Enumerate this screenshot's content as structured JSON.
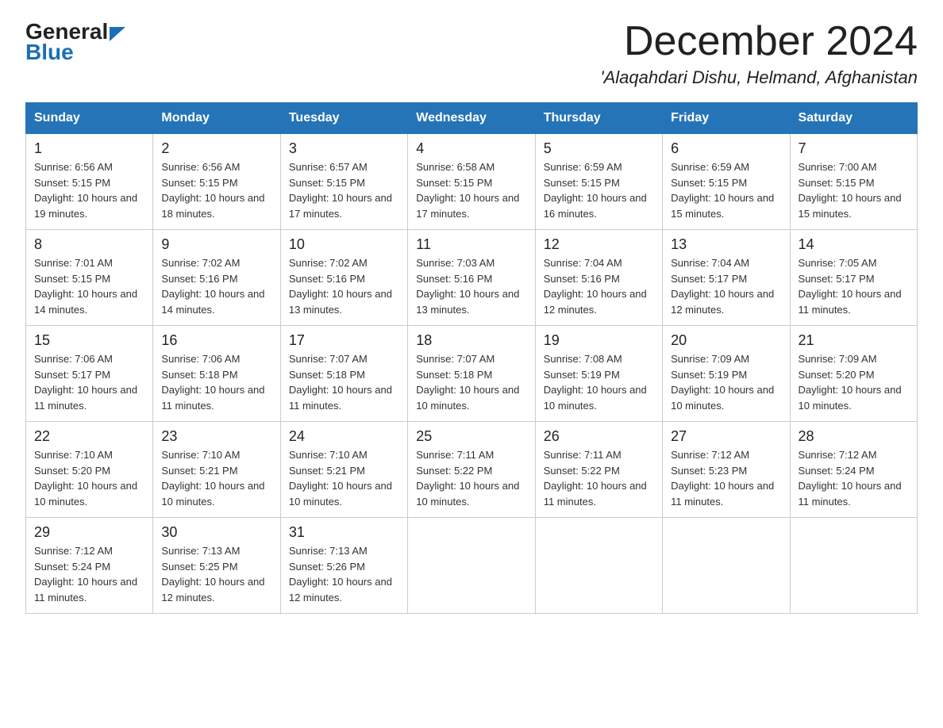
{
  "header": {
    "title": "December 2024",
    "subtitle": "'Alaqahdari Dishu, Helmand, Afghanistan",
    "logo_general": "General",
    "logo_blue": "Blue"
  },
  "days_of_week": [
    "Sunday",
    "Monday",
    "Tuesday",
    "Wednesday",
    "Thursday",
    "Friday",
    "Saturday"
  ],
  "weeks": [
    [
      {
        "date": "1",
        "sunrise": "6:56 AM",
        "sunset": "5:15 PM",
        "daylight": "10 hours and 19 minutes."
      },
      {
        "date": "2",
        "sunrise": "6:56 AM",
        "sunset": "5:15 PM",
        "daylight": "10 hours and 18 minutes."
      },
      {
        "date": "3",
        "sunrise": "6:57 AM",
        "sunset": "5:15 PM",
        "daylight": "10 hours and 17 minutes."
      },
      {
        "date": "4",
        "sunrise": "6:58 AM",
        "sunset": "5:15 PM",
        "daylight": "10 hours and 17 minutes."
      },
      {
        "date": "5",
        "sunrise": "6:59 AM",
        "sunset": "5:15 PM",
        "daylight": "10 hours and 16 minutes."
      },
      {
        "date": "6",
        "sunrise": "6:59 AM",
        "sunset": "5:15 PM",
        "daylight": "10 hours and 15 minutes."
      },
      {
        "date": "7",
        "sunrise": "7:00 AM",
        "sunset": "5:15 PM",
        "daylight": "10 hours and 15 minutes."
      }
    ],
    [
      {
        "date": "8",
        "sunrise": "7:01 AM",
        "sunset": "5:15 PM",
        "daylight": "10 hours and 14 minutes."
      },
      {
        "date": "9",
        "sunrise": "7:02 AM",
        "sunset": "5:16 PM",
        "daylight": "10 hours and 14 minutes."
      },
      {
        "date": "10",
        "sunrise": "7:02 AM",
        "sunset": "5:16 PM",
        "daylight": "10 hours and 13 minutes."
      },
      {
        "date": "11",
        "sunrise": "7:03 AM",
        "sunset": "5:16 PM",
        "daylight": "10 hours and 13 minutes."
      },
      {
        "date": "12",
        "sunrise": "7:04 AM",
        "sunset": "5:16 PM",
        "daylight": "10 hours and 12 minutes."
      },
      {
        "date": "13",
        "sunrise": "7:04 AM",
        "sunset": "5:17 PM",
        "daylight": "10 hours and 12 minutes."
      },
      {
        "date": "14",
        "sunrise": "7:05 AM",
        "sunset": "5:17 PM",
        "daylight": "10 hours and 11 minutes."
      }
    ],
    [
      {
        "date": "15",
        "sunrise": "7:06 AM",
        "sunset": "5:17 PM",
        "daylight": "10 hours and 11 minutes."
      },
      {
        "date": "16",
        "sunrise": "7:06 AM",
        "sunset": "5:18 PM",
        "daylight": "10 hours and 11 minutes."
      },
      {
        "date": "17",
        "sunrise": "7:07 AM",
        "sunset": "5:18 PM",
        "daylight": "10 hours and 11 minutes."
      },
      {
        "date": "18",
        "sunrise": "7:07 AM",
        "sunset": "5:18 PM",
        "daylight": "10 hours and 10 minutes."
      },
      {
        "date": "19",
        "sunrise": "7:08 AM",
        "sunset": "5:19 PM",
        "daylight": "10 hours and 10 minutes."
      },
      {
        "date": "20",
        "sunrise": "7:09 AM",
        "sunset": "5:19 PM",
        "daylight": "10 hours and 10 minutes."
      },
      {
        "date": "21",
        "sunrise": "7:09 AM",
        "sunset": "5:20 PM",
        "daylight": "10 hours and 10 minutes."
      }
    ],
    [
      {
        "date": "22",
        "sunrise": "7:10 AM",
        "sunset": "5:20 PM",
        "daylight": "10 hours and 10 minutes."
      },
      {
        "date": "23",
        "sunrise": "7:10 AM",
        "sunset": "5:21 PM",
        "daylight": "10 hours and 10 minutes."
      },
      {
        "date": "24",
        "sunrise": "7:10 AM",
        "sunset": "5:21 PM",
        "daylight": "10 hours and 10 minutes."
      },
      {
        "date": "25",
        "sunrise": "7:11 AM",
        "sunset": "5:22 PM",
        "daylight": "10 hours and 10 minutes."
      },
      {
        "date": "26",
        "sunrise": "7:11 AM",
        "sunset": "5:22 PM",
        "daylight": "10 hours and 11 minutes."
      },
      {
        "date": "27",
        "sunrise": "7:12 AM",
        "sunset": "5:23 PM",
        "daylight": "10 hours and 11 minutes."
      },
      {
        "date": "28",
        "sunrise": "7:12 AM",
        "sunset": "5:24 PM",
        "daylight": "10 hours and 11 minutes."
      }
    ],
    [
      {
        "date": "29",
        "sunrise": "7:12 AM",
        "sunset": "5:24 PM",
        "daylight": "10 hours and 11 minutes."
      },
      {
        "date": "30",
        "sunrise": "7:13 AM",
        "sunset": "5:25 PM",
        "daylight": "10 hours and 12 minutes."
      },
      {
        "date": "31",
        "sunrise": "7:13 AM",
        "sunset": "5:26 PM",
        "daylight": "10 hours and 12 minutes."
      },
      null,
      null,
      null,
      null
    ]
  ]
}
